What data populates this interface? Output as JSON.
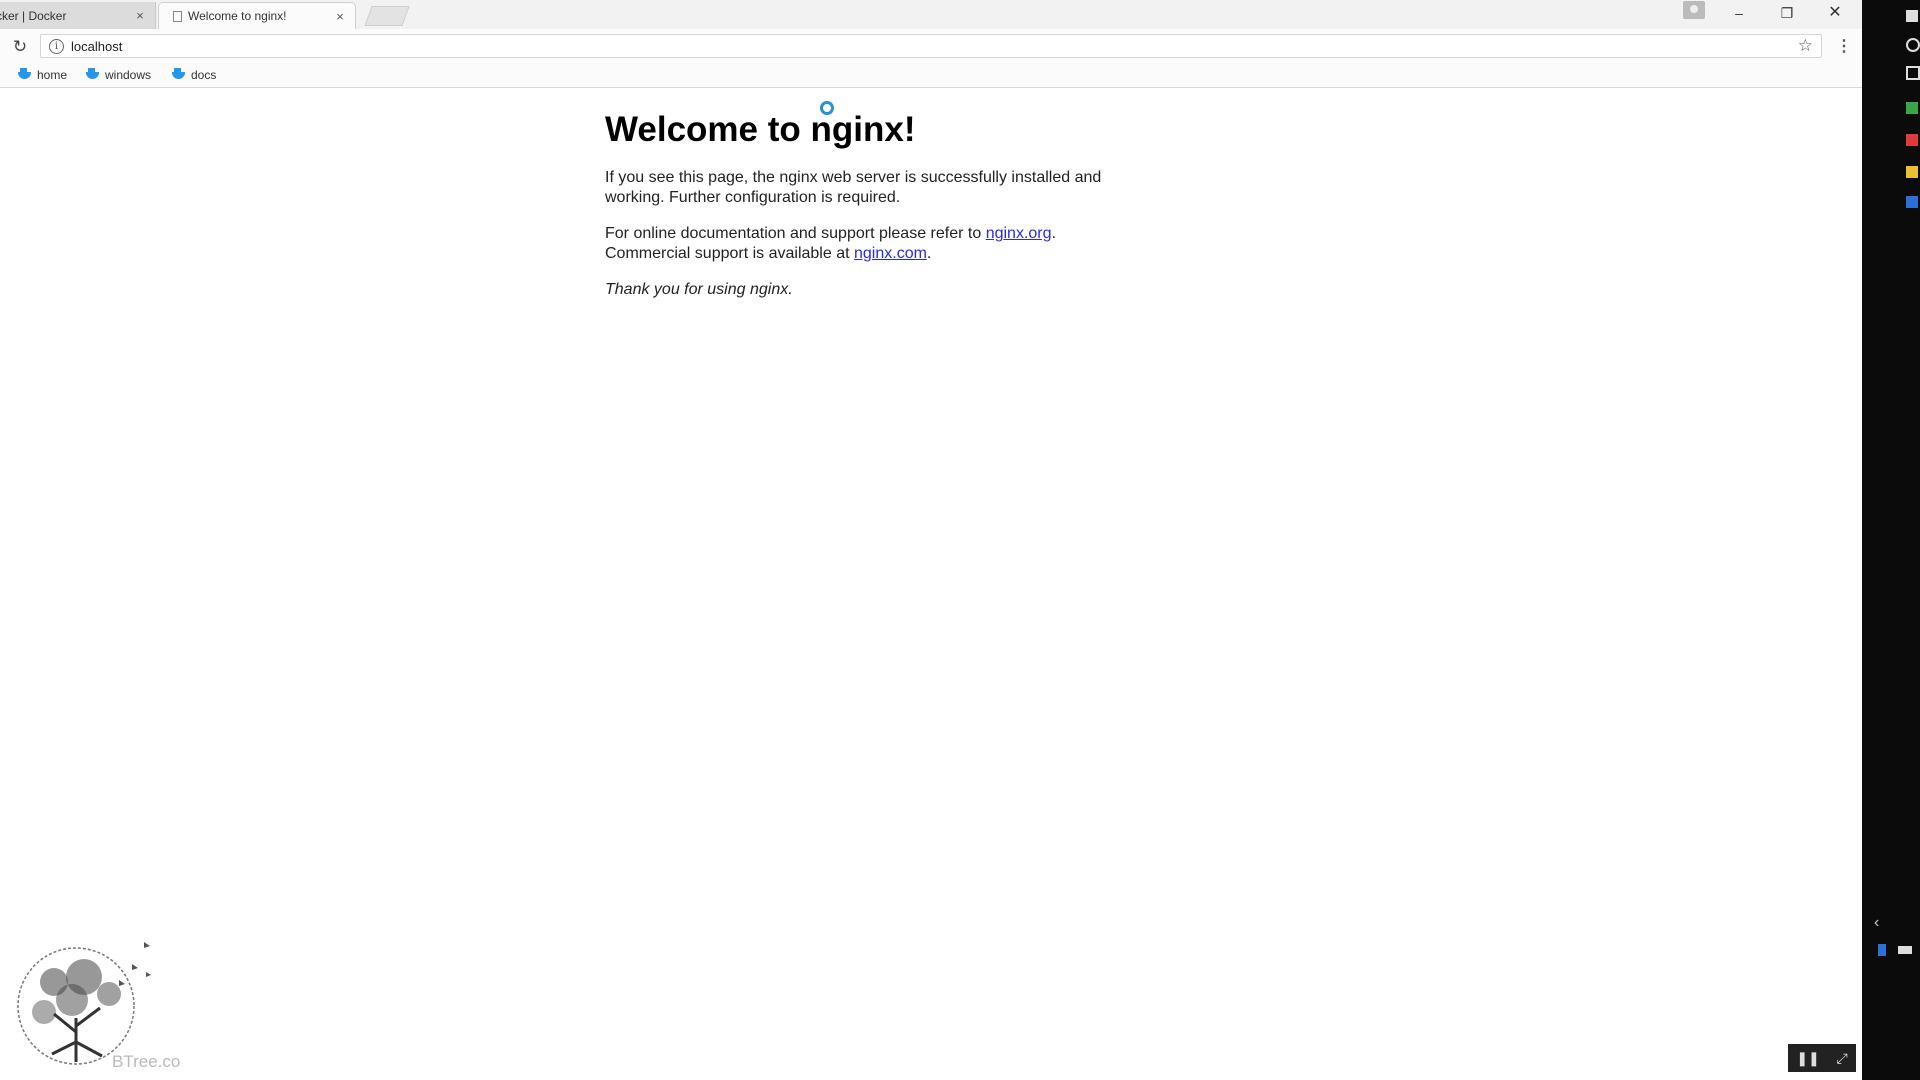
{
  "browser": {
    "tabs": [
      {
        "label": "cker | Docker",
        "active": false
      },
      {
        "label": "Welcome to nginx!",
        "active": true
      }
    ],
    "tab_close_glyph": "×",
    "window_controls": {
      "minimize": "–",
      "maximize": "❐",
      "close": "✕"
    },
    "address_bar": {
      "url": "localhost"
    },
    "bookmarks": [
      {
        "label": "home"
      },
      {
        "label": "windows"
      },
      {
        "label": "docs"
      }
    ]
  },
  "page": {
    "heading": "Welcome to nginx!",
    "para1": "If you see this page, the nginx web server is successfully installed and working. Further configuration is required.",
    "para2_prefix": "For online documentation and support please refer to ",
    "para2_link": "nginx.org",
    "para2_mid": ".",
    "para2_line2_prefix": "Commercial support is available at ",
    "para2_link2": "nginx.com",
    "para2_suffix": ".",
    "thanks": "Thank you for using nginx."
  },
  "watermark": {
    "text": "BTree.co"
  },
  "colors": {
    "link": "#2a2ae0",
    "docker_blue": "#2496ed",
    "taskbar": "#0b0b0b"
  }
}
